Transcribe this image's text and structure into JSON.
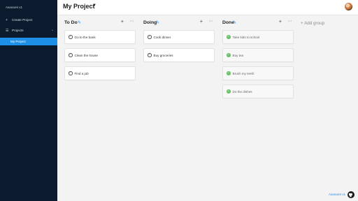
{
  "app": {
    "title": "Asanaret v1"
  },
  "sidebar": {
    "create_label": "Create Project",
    "projects_label": "Projects",
    "active_project": "My Project"
  },
  "header": {
    "project_title": "My Project"
  },
  "board": {
    "add_group_label": "+ Add group",
    "columns": [
      {
        "title": "To Do",
        "tasks": [
          "Go to the bank",
          "Clean the house",
          "Find a job"
        ],
        "done": false
      },
      {
        "title": "Doing",
        "tasks": [
          "Cook dinner",
          "Buy groceries"
        ],
        "done": false
      },
      {
        "title": "Done",
        "tasks": [
          "Take kids to school",
          "Buy tea",
          "Brush my teeth",
          "Do the dishes"
        ],
        "done": true
      }
    ]
  },
  "footer": {
    "link_label": "Asanaret v1"
  },
  "colors": {
    "sidebar_bg": "#0b1b2d",
    "accent": "#1e8fe6",
    "done_check": "#6cc36c"
  },
  "icons": [
    "plus-icon",
    "list-icon",
    "chevron-up-icon",
    "caret-down-icon",
    "pencil-icon",
    "more-icon",
    "check-circle-icon",
    "github-icon"
  ]
}
